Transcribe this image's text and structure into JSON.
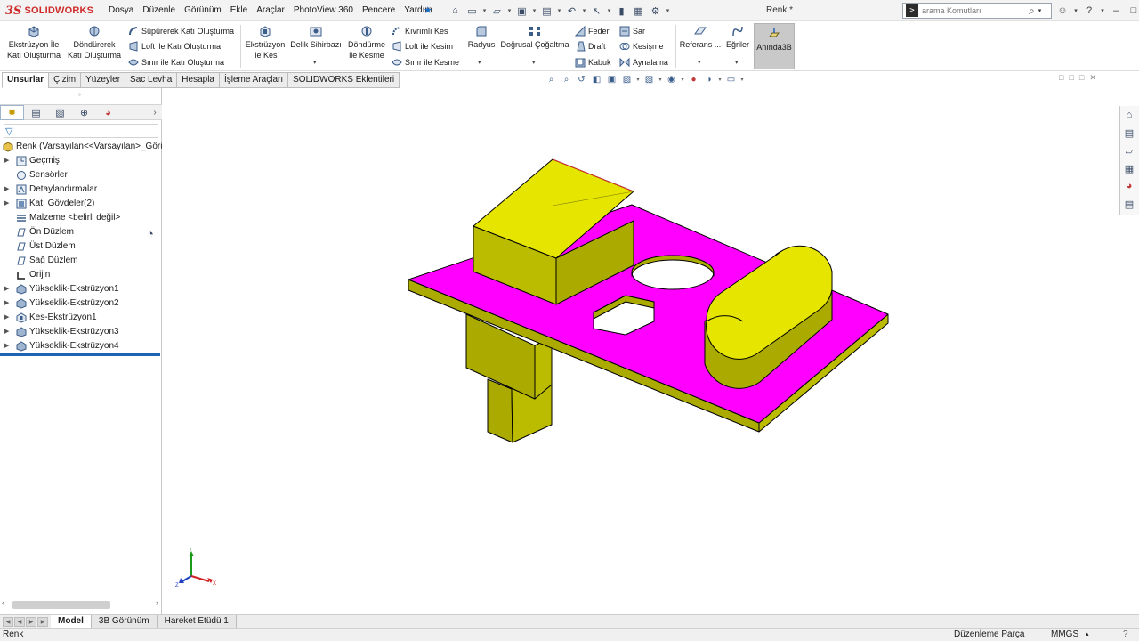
{
  "app": {
    "brand_ds": "3S",
    "brand_name": "SOLIDWORKS",
    "doc_title": "Renk *"
  },
  "menus": [
    "Dosya",
    "Düzenle",
    "Görünüm",
    "Ekle",
    "Araçlar",
    "PhotoView 360",
    "Pencere",
    "Yardım"
  ],
  "search": {
    "placeholder": "arama Komutları"
  },
  "ribbon": {
    "extrude_boss_line1": "Ekstrüzyon İle",
    "extrude_boss_line2": "Katı Oluşturma",
    "revolve_boss_line1": "Döndürerek",
    "revolve_boss_line2": "Katı Oluşturma",
    "sweep_boss": "Süpürerek Katı Oluşturma",
    "loft_boss": "Loft ile Katı Oluşturma",
    "boundary_boss": "Sınır ile Katı Oluşturma",
    "extrude_cut_line1": "Ekstrüzyon",
    "extrude_cut_line2": "ile Kes",
    "hole_wizard": "Delik Sihirbazı",
    "revolve_cut_line1": "Döndürme",
    "revolve_cut_line2": "ile Kesme",
    "swept_cut": "Kıvrımlı Kes",
    "loft_cut": "Loft ile Kesim",
    "boundary_cut": "Sınır ile Kesme",
    "fillet": "Radyus",
    "linear_pattern": "Doğrusal Çoğaltma",
    "rib": "Feder",
    "draft": "Draft",
    "shell": "Kabuk",
    "wrap": "Sar",
    "intersect": "Kesişme",
    "mirror": "Aynalama",
    "reference": "Referans ...",
    "curves": "Eğriler",
    "instant3d": "Anında3B"
  },
  "cm_tabs": [
    "Unsurlar",
    "Çizim",
    "Yüzeyler",
    "Sac Levha",
    "Hesapla",
    "İşleme Araçları",
    "SOLIDWORKS Eklentileri"
  ],
  "tree": {
    "root": "Renk  (Varsayılan<<Varsayılan>_Görü",
    "items": [
      {
        "label": "Geçmiş",
        "icon": "history-icon",
        "arrow": true
      },
      {
        "label": "Sensörler",
        "icon": "sensor-icon",
        "arrow": false
      },
      {
        "label": "Detaylandırmalar",
        "icon": "annotations-icon",
        "arrow": true
      },
      {
        "label": "Katı Gövdeler(2)",
        "icon": "solid-bodies-icon",
        "arrow": true
      },
      {
        "label": "Malzeme <belirli değil>",
        "icon": "material-icon",
        "arrow": false
      },
      {
        "label": "Ön Düzlem",
        "icon": "plane-icon",
        "arrow": false
      },
      {
        "label": "Üst Düzlem",
        "icon": "plane-icon",
        "arrow": false
      },
      {
        "label": "Sağ Düzlem",
        "icon": "plane-icon",
        "arrow": false
      },
      {
        "label": "Orijin",
        "icon": "origin-icon",
        "arrow": false
      },
      {
        "label": "Yükseklik-Ekstrüzyon1",
        "icon": "extrude-feature-icon",
        "arrow": true
      },
      {
        "label": "Yükseklik-Ekstrüzyon2",
        "icon": "extrude-feature-icon",
        "arrow": true
      },
      {
        "label": "Kes-Ekstrüzyon1",
        "icon": "cut-feature-icon",
        "arrow": true
      },
      {
        "label": "Yükseklik-Ekstrüzyon3",
        "icon": "extrude-feature-icon",
        "arrow": true
      },
      {
        "label": "Yükseklik-Ekstrüzyon4",
        "icon": "extrude-feature-icon",
        "arrow": true
      }
    ]
  },
  "bottom_tabs": [
    "Model",
    "3B Görünüm",
    "Hareket Etüdü 1"
  ],
  "status": {
    "left": "Renk",
    "mode": "Düzenleme Parça",
    "units": "MMGS",
    "help": "?"
  },
  "colors": {
    "face_magenta": "#ff00ff",
    "face_yellow": "#cccc00",
    "accent_blue": "#1e64b4",
    "brand_red": "#cf2b2b"
  },
  "triad": {
    "x": "X",
    "y": "Y",
    "z": "Z"
  }
}
